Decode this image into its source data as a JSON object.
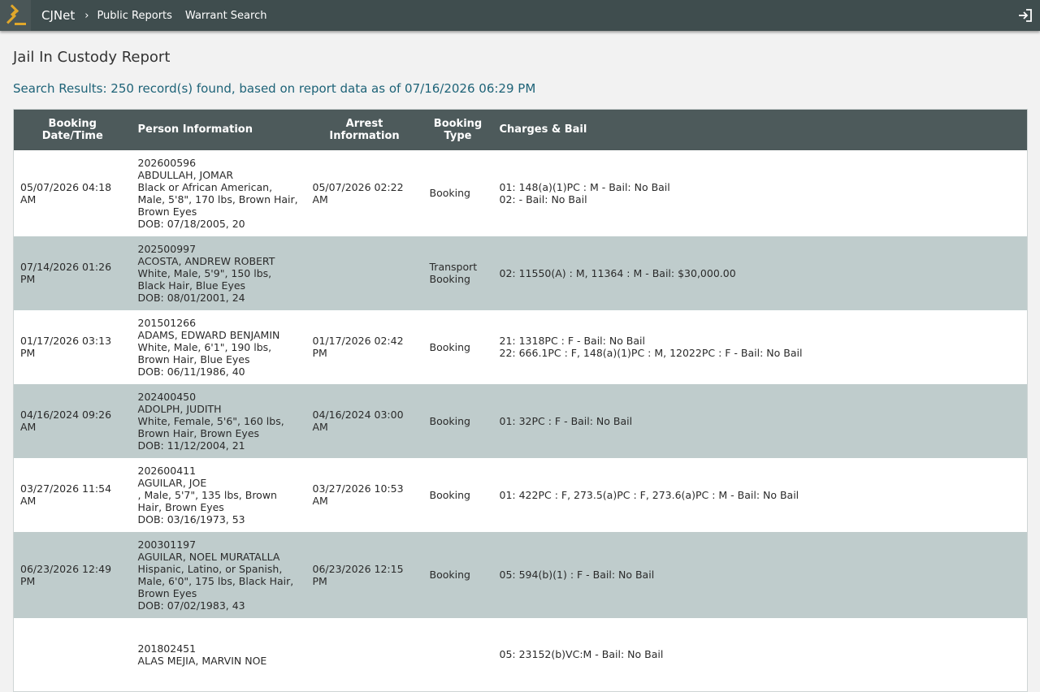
{
  "nav": {
    "brand": "CJNet",
    "separator": "›",
    "links": [
      "Public Reports",
      "Warrant Search"
    ],
    "icons": {
      "logo": "gavel-icon",
      "login": "sign-in-icon"
    }
  },
  "page": {
    "title": "Jail In Custody Report",
    "summary": "Search Results: 250 record(s) found, based on report data as of 07/16/2026 06:29 PM"
  },
  "table": {
    "headers": {
      "booking_datetime": "Booking Date/Time",
      "person_info": "Person Information",
      "arrest_info": "Arrest Information",
      "booking_type": "Booking Type",
      "charges_bail": "Charges & Bail"
    },
    "rows": [
      {
        "booking": "05/07/2026 04:18 AM",
        "person": [
          "202600596",
          "ABDULLAH, JOMAR",
          "Black or African American, Male, 5'8\", 170 lbs, Brown Hair, Brown Eyes",
          "DOB: 07/18/2005, 20"
        ],
        "arrest": "05/07/2026 02:22 AM",
        "type": "Booking",
        "charges": [
          "01: 148(a)(1)PC : M - Bail: No Bail",
          "02: - Bail: No Bail"
        ]
      },
      {
        "booking": "07/14/2026 01:26 PM",
        "person": [
          "202500997",
          "ACOSTA, ANDREW ROBERT",
          "White, Male, 5'9\", 150 lbs, Black Hair, Blue Eyes",
          "DOB: 08/01/2001, 24"
        ],
        "arrest": "",
        "type": "Transport Booking",
        "charges": [
          "02: 11550(A) : M, 11364 : M - Bail: $30,000.00"
        ]
      },
      {
        "booking": "01/17/2026 03:13 PM",
        "person": [
          "201501266",
          "ADAMS, EDWARD BENJAMIN",
          "White, Male, 6'1\", 190 lbs, Brown Hair, Blue Eyes",
          "DOB: 06/11/1986, 40"
        ],
        "arrest": "01/17/2026 02:42 PM",
        "type": "Booking",
        "charges": [
          "21: 1318PC : F - Bail: No Bail",
          "22: 666.1PC : F, 148(a)(1)PC : M, 12022PC : F - Bail: No Bail"
        ]
      },
      {
        "booking": "04/16/2024 09:26 AM",
        "person": [
          "202400450",
          "ADOLPH, JUDITH",
          "White, Female, 5'6\", 160 lbs, Brown Hair, Brown Eyes",
          "DOB: 11/12/2004, 21"
        ],
        "arrest": "04/16/2024 03:00 AM",
        "type": "Booking",
        "charges": [
          "01: 32PC : F - Bail: No Bail"
        ]
      },
      {
        "booking": "03/27/2026 11:54 AM",
        "person": [
          "202600411",
          "AGUILAR, JOE",
          ", Male, 5'7\", 135 lbs, Brown Hair, Brown Eyes",
          "DOB: 03/16/1973, 53"
        ],
        "arrest": "03/27/2026 10:53 AM",
        "type": "Booking",
        "charges": [
          "01: 422PC : F, 273.5(a)PC : F, 273.6(a)PC : M - Bail: No Bail"
        ]
      },
      {
        "booking": "06/23/2026 12:49 PM",
        "person": [
          "200301197",
          "AGUILAR, NOEL MURATALLA",
          "Hispanic, Latino, or Spanish, Male, 6'0\", 175 lbs, Black Hair, Brown Eyes",
          "DOB: 07/02/1983, 43"
        ],
        "arrest": "06/23/2026 12:15 PM",
        "type": "Booking",
        "charges": [
          "05: 594(b)(1) : F - Bail: No Bail"
        ]
      },
      {
        "booking": "",
        "person": [
          "201802451",
          "ALAS MEJIA, MARVIN NOE",
          "",
          ""
        ],
        "arrest": "",
        "type": "",
        "charges": [
          "05: 23152(b)VC:M - Bail: No Bail"
        ]
      }
    ]
  },
  "colors": {
    "topbar": "#3f4d4e",
    "header": "#4d5a5b",
    "row_alt": "#bfcccc",
    "summary_text": "#1e6378",
    "logo_gold": "#e0a72a"
  }
}
